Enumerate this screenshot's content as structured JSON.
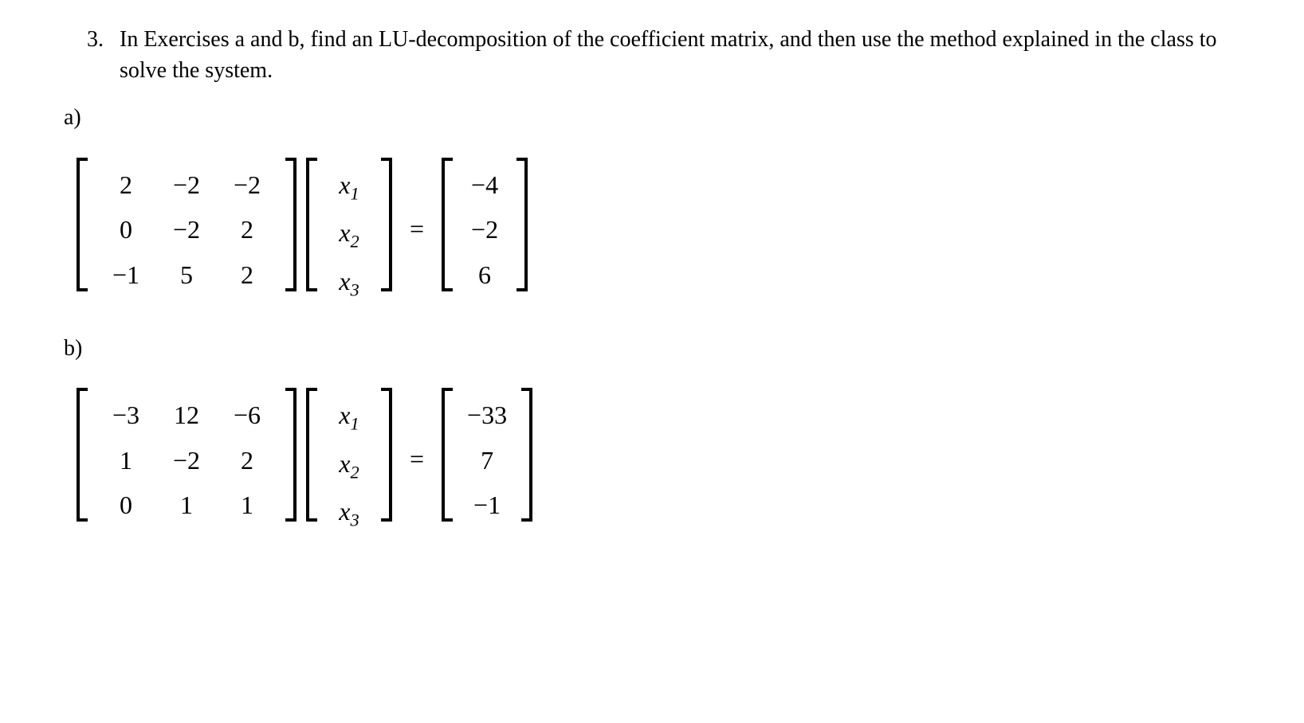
{
  "problem": {
    "number": "3.",
    "text": "In Exercises a and b, find an LU-decomposition of the coefficient matrix, and then use the method explained in the class to solve the system."
  },
  "parts": {
    "a": {
      "label": "a)",
      "matrix_A": [
        [
          "2",
          "−2",
          "−2"
        ],
        [
          "0",
          "−2",
          "2"
        ],
        [
          "−1",
          "5",
          "2"
        ]
      ],
      "vector_x": [
        "x1",
        "x2",
        "x3"
      ],
      "vector_b": [
        "−4",
        "−2",
        "6"
      ]
    },
    "b": {
      "label": "b)",
      "matrix_A": [
        [
          "−3",
          "12",
          "−6"
        ],
        [
          "1",
          "−2",
          "2"
        ],
        [
          "0",
          "1",
          "1"
        ]
      ],
      "vector_x": [
        "x1",
        "x2",
        "x3"
      ],
      "vector_b": [
        "−33",
        "7",
        "−1"
      ]
    }
  },
  "equals": "="
}
